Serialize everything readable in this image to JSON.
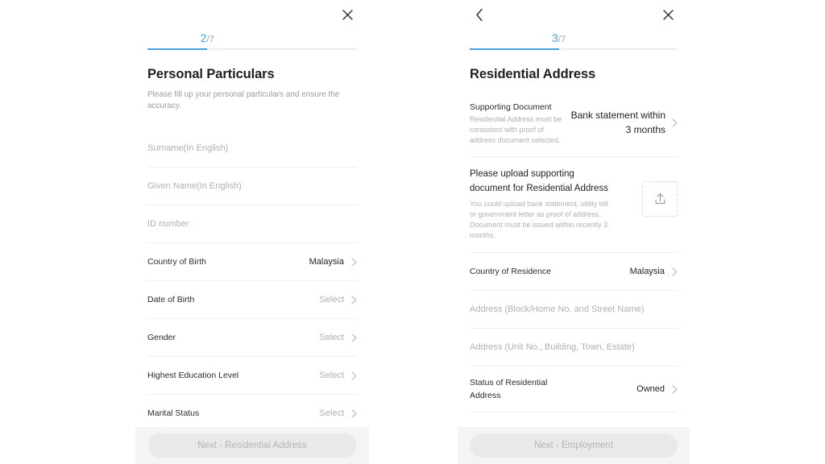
{
  "theme": {
    "accent": "#4a9fe0",
    "page_bg": "#ffffff",
    "footer_bg": "#f4f4f5",
    "divider": "#eeeeee",
    "text_primary": "#1f1f1f",
    "text_muted": "#b0b0b0",
    "button_disabled_bg": "#e9e9eb",
    "button_disabled_text": "#b4b4b8"
  },
  "left_panel": {
    "nav": {
      "close_icon": "close-icon"
    },
    "progress": {
      "current": "2",
      "separator": "/",
      "total": "7",
      "percent": 28.6
    },
    "title": "Personal Particulars",
    "subtitle": "Please fill up your personal particulars and ensure the accuracy.",
    "fields": [
      {
        "type": "input",
        "placeholder": "Surname(In English)",
        "name": "surname"
      },
      {
        "type": "input",
        "placeholder": "Given Name(In English)",
        "name": "given-name"
      },
      {
        "type": "input",
        "placeholder": "ID number",
        "name": "id-number"
      },
      {
        "type": "select",
        "label": "Country of Birth",
        "value": "Malaysia",
        "name": "country-of-birth",
        "is_placeholder": false
      },
      {
        "type": "select",
        "label": "Date of Birth",
        "value": "Select",
        "name": "date-of-birth",
        "is_placeholder": true
      },
      {
        "type": "select",
        "label": "Gender",
        "value": "Select",
        "name": "gender",
        "is_placeholder": true
      },
      {
        "type": "select",
        "label": "Highest Education Level",
        "value": "Select",
        "name": "highest-education",
        "is_placeholder": true
      },
      {
        "type": "select",
        "label": "Marital Status",
        "value": "Select",
        "name": "marital-status",
        "is_placeholder": true
      }
    ],
    "next_button": "Next - Residential Address"
  },
  "right_panel": {
    "nav": {
      "back_icon": "chevron-left-icon",
      "close_icon": "close-icon"
    },
    "progress": {
      "current": "3",
      "separator": "/",
      "total": "7",
      "percent": 42.9
    },
    "title": "Residential Address",
    "supporting_document": {
      "label": "Supporting Document",
      "description": "Residential Address must be consistent with proof of address document selected.",
      "value": "Bank statement within 3 months"
    },
    "upload": {
      "heading": "Please upload supporting document for Residential Address",
      "description": "You could upload bank statement, utility bill or government letter as proof of address. Document must be issued within recently 3 months.",
      "icon": "upload-icon"
    },
    "fields": [
      {
        "type": "select",
        "label": "Country of Residence",
        "value": "Malaysia",
        "name": "country-of-residence",
        "is_placeholder": false
      },
      {
        "type": "input",
        "placeholder": "Address (Block/Home No. and Street Name)",
        "name": "address-line-1"
      },
      {
        "type": "input",
        "placeholder": "Address (Unit No., Building, Town, Estate)",
        "name": "address-line-2"
      },
      {
        "type": "select",
        "label": "Status of Residential Address",
        "value": "Owned",
        "name": "status-of-residential-address",
        "is_placeholder": false
      }
    ],
    "next_button": "Next - Employment"
  }
}
